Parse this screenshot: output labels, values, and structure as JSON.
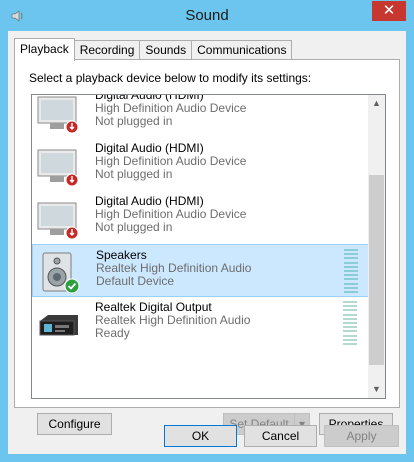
{
  "window": {
    "title": "Sound",
    "close_label": "✕"
  },
  "tabs": [
    {
      "label": "Playback",
      "active": true
    },
    {
      "label": "Recording",
      "active": false
    },
    {
      "label": "Sounds",
      "active": false
    },
    {
      "label": "Communications",
      "active": false
    }
  ],
  "playback": {
    "instruction": "Select a playback device below to modify its settings:",
    "devices": [
      {
        "name": "Digital Audio (HDMI)",
        "driver": "High Definition Audio Device",
        "status": "Not plugged in",
        "icon": "monitor-unplugged-icon"
      },
      {
        "name": "Digital Audio (HDMI)",
        "driver": "High Definition Audio Device",
        "status": "Not plugged in",
        "icon": "monitor-unplugged-icon"
      },
      {
        "name": "Digital Audio (HDMI)",
        "driver": "High Definition Audio Device",
        "status": "Not plugged in",
        "icon": "monitor-unplugged-icon"
      },
      {
        "name": "Speakers",
        "driver": "Realtek High Definition Audio",
        "status": "Default Device",
        "icon": "speaker-default-icon",
        "selected": true
      },
      {
        "name": "Realtek Digital Output",
        "driver": "Realtek High Definition Audio",
        "status": "Ready",
        "icon": "digital-output-icon"
      }
    ],
    "buttons": {
      "configure": "Configure",
      "set_default": "Set Default",
      "properties": "Properties"
    }
  },
  "dialog_buttons": {
    "ok": "OK",
    "cancel": "Cancel",
    "apply": "Apply"
  },
  "colors": {
    "selection": "#cce8ff",
    "title_bar": "#6bc5ee",
    "close": "#c7372f"
  }
}
